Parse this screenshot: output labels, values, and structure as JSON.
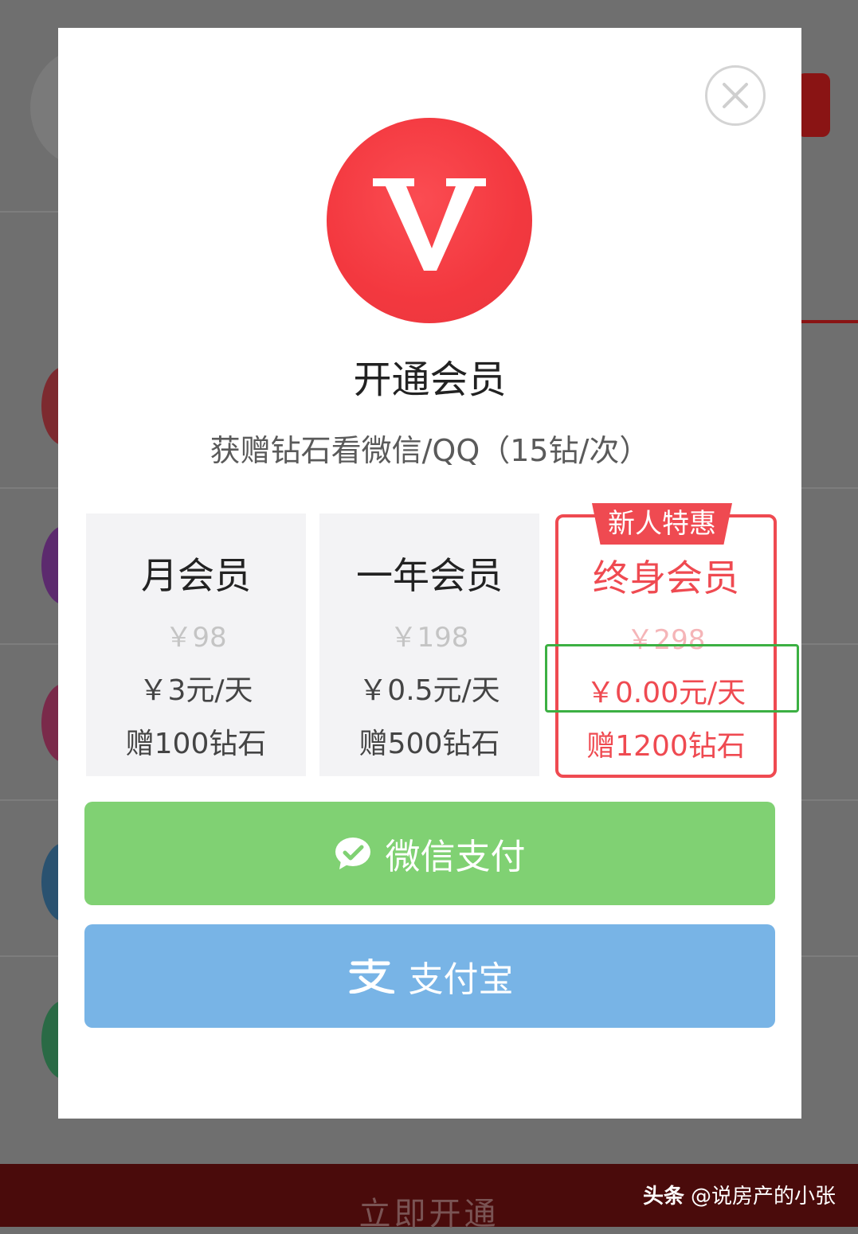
{
  "background": {
    "bottom_button_label": "立即开通",
    "watermark_source": "头条",
    "watermark_handle": "@说房产的小张"
  },
  "dialog": {
    "title": "开通会员",
    "subtitle": "获赠钻石看微信/QQ（15钻/次）",
    "close_icon": "close-icon",
    "logo_icon": "vip-v-icon"
  },
  "plans": [
    {
      "name": "月会员",
      "original_price": "￥98",
      "daily_price": "￥3元/天",
      "gift": "赠100钻石"
    },
    {
      "name": "一年会员",
      "original_price": "￥198",
      "daily_price": "￥0.5元/天",
      "gift": "赠500钻石"
    },
    {
      "name": "终身会员",
      "original_price": "￥298",
      "daily_price": "￥0.00元/天",
      "gift": "赠1200钻石",
      "badge": "新人特惠"
    }
  ],
  "payment": {
    "wechat_label": "微信支付",
    "alipay_label": "支付宝"
  },
  "colors": {
    "accent_red": "#ef4a51",
    "wechat_green": "#80d173",
    "alipay_blue": "#78b4e6",
    "highlight_green": "#3cb043"
  }
}
